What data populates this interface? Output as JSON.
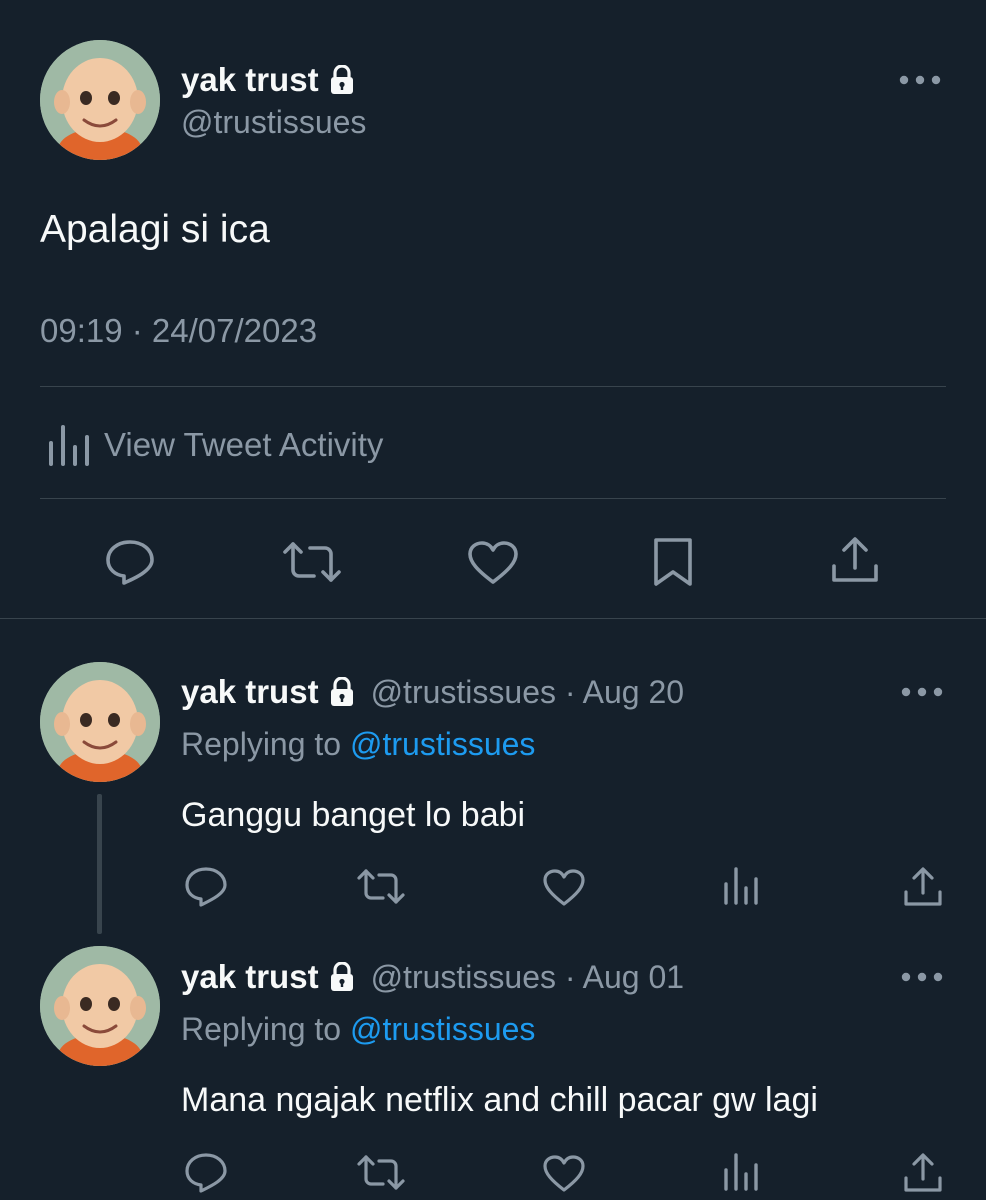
{
  "tweet": {
    "author_name": "yak trust",
    "author_handle": "@trustissues",
    "text": "Apalagi si ica",
    "timestamp": "09:19 · 24/07/2023",
    "activity_label": "View Tweet Activity"
  },
  "replies": [
    {
      "author_name": "yak trust",
      "meta": "@trustissues · Aug 20",
      "replying_prefix": "Replying to",
      "replying_handle": "@trustissues",
      "text": "Ganggu banget lo babi"
    },
    {
      "author_name": "yak trust",
      "meta": "@trustissues · Aug 01",
      "replying_prefix": "Replying to",
      "replying_handle": "@trustissues",
      "text": "Mana ngajak netflix and chill pacar gw lagi"
    }
  ],
  "icons": {
    "lock": "lock-icon",
    "more": "more-icon",
    "activity": "analytics-icon",
    "reply": "reply-icon",
    "retweet": "retweet-icon",
    "like": "heart-icon",
    "bookmark": "bookmark-icon",
    "share": "share-icon"
  },
  "colors": {
    "background": "#15202b",
    "text": "#f7f9f9",
    "muted": "#8b98a5",
    "link": "#1d9bf0",
    "divider": "#38444d"
  }
}
